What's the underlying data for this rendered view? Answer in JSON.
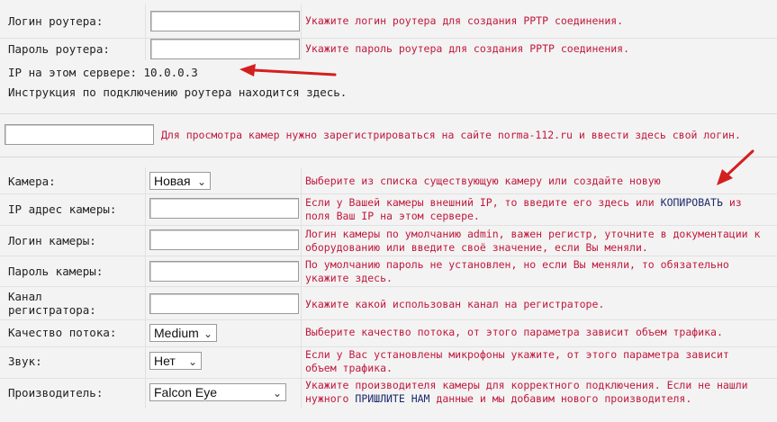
{
  "router": {
    "login_label": "Логин роутера:",
    "login_value": "",
    "login_hint": "Укажите логин роутера для создания PPTP соединения.",
    "password_label": "Пароль роутера:",
    "password_value": "",
    "password_hint": "Укажите пароль роутера для создания PPTP соединения.",
    "ip_text": "IP на этом сервере: 10.0.0.3",
    "instruction_prefix": "Инструкция по подключению роутера находится ",
    "instruction_link": "здесь",
    "instruction_suffix": "."
  },
  "register": {
    "login_value": "",
    "hint": "Для просмотра камер нужно зарегистрироваться на сайте norma-112.ru и ввести здесь свой логин."
  },
  "camera": {
    "camera_label": "Камера:",
    "camera_select": "Новая",
    "camera_hint": "Выберите из списка существующую камеру или создайте новую",
    "ip_label": "IP адрес камеры:",
    "ip_value": "",
    "ip_hint_1": "Если у Вашей камеры внешний IP, то введите его здесь или ",
    "ip_hint_link": "КОПИРОВАТЬ",
    "ip_hint_2": " из",
    "ip_hint_3": "поля Ваш IP на этом сервере.",
    "login_label": "Логин камеры:",
    "login_value": "",
    "login_hint_1": "Логин камеры по умолчанию admin, важен регистр, уточните в документации к",
    "login_hint_2": "оборудованию или введите своё значение, если Вы меняли.",
    "password_label": "Пароль камеры:",
    "password_value": "",
    "password_hint_1": "По умолчанию пароль не установлен, но если Вы меняли, то обязательно",
    "password_hint_2": "укажите здесь.",
    "channel_label_1": "Канал",
    "channel_label_2": "регистратора:",
    "channel_value": "",
    "channel_hint": "Укажите какой использован канал на регистраторе.",
    "quality_label": "Качество потока:",
    "quality_select": "Medium",
    "quality_hint": "Выберите качество потока, от этого параметра зависит объем трафика.",
    "sound_label": "Звук:",
    "sound_select": "Нет",
    "sound_hint_1": "Если у Вас установлены микрофоны укажите, от этого параметра зависит",
    "sound_hint_2": "объем трафика.",
    "vendor_label": "Производитель:",
    "vendor_select": "Falcon Eye",
    "vendor_hint_1": "Укажите производителя камеры для корректного подключения. Если не нашли",
    "vendor_hint_2a": "нужного ",
    "vendor_hint_link": "ПРИШЛИТЕ НАМ",
    "vendor_hint_2b": " данные и мы добавим нового производителя."
  },
  "colors": {
    "hint": "#c0193c",
    "link": "#1d2a6b",
    "arrow": "#d41f1f",
    "background": "#f3f3f3"
  },
  "icons": {
    "select_caret": "chevron-down-icon",
    "annotation": "red-arrow-icon"
  }
}
